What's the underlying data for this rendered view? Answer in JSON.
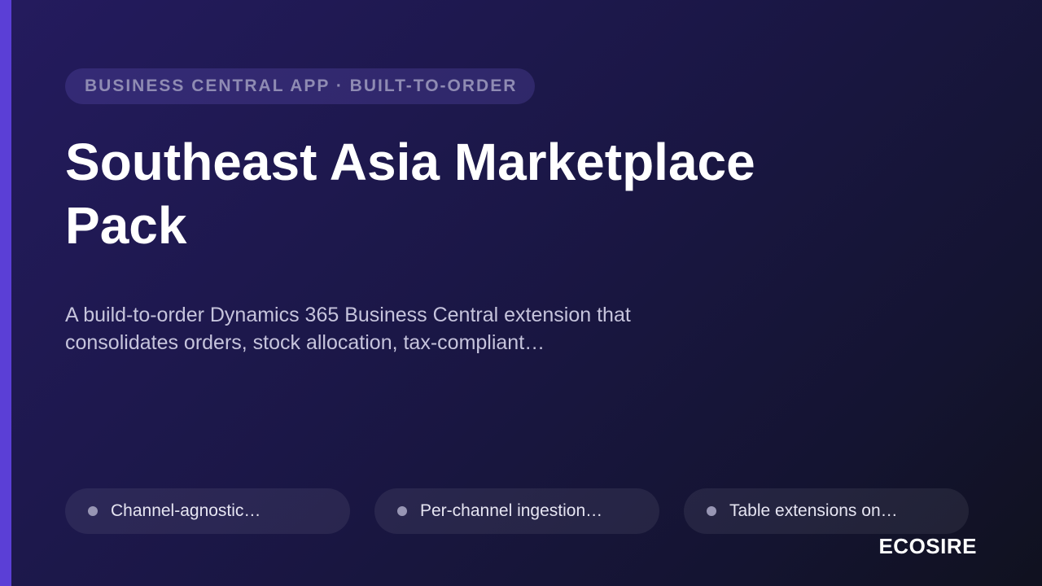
{
  "eyebrow": "BUSINESS CENTRAL APP · BUILT-TO-ORDER",
  "title": "Southeast Asia Marketplace Pack",
  "description": "A build-to-order Dynamics 365 Business Central extension that consolidates orders, stock allocation, tax-compliant…",
  "features": [
    {
      "label": "Channel-agnostic…",
      "icon": "dot-icon"
    },
    {
      "label": "Per-channel ingestion…",
      "icon": "dot-icon"
    },
    {
      "label": "Table extensions on…",
      "icon": "dot-icon"
    }
  ],
  "brand": "ECOSIRE",
  "colors": {
    "accent": "#5b3fd6",
    "background_start": "#241b5e",
    "background_end": "#10111f"
  }
}
